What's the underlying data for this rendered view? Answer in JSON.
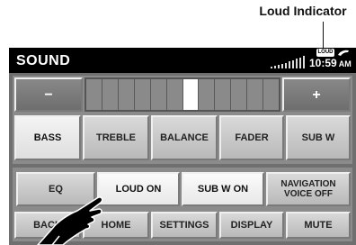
{
  "callout": {
    "label": "Loud Indicator"
  },
  "header": {
    "title": "SOUND",
    "time": "10:59",
    "ampm": "AM",
    "loud_badge": "LOUD"
  },
  "adjust": {
    "minus": "−",
    "plus": "+",
    "segments": 12,
    "active_segment": 6
  },
  "tabs": [
    {
      "label": "BASS",
      "state": "selected"
    },
    {
      "label": "TREBLE",
      "state": "normal"
    },
    {
      "label": "BALANCE",
      "state": "normal"
    },
    {
      "label": "FADER",
      "state": "normal"
    },
    {
      "label": "SUB W",
      "state": "normal"
    }
  ],
  "options": [
    {
      "label": "EQ",
      "state": "normal"
    },
    {
      "label": "LOUD ON",
      "state": "active"
    },
    {
      "label": "SUB W ON",
      "state": "active"
    },
    {
      "label": "NAVIGATION VOICE OFF",
      "state": "normal"
    }
  ],
  "bottom_bar": [
    {
      "label": "BACK"
    },
    {
      "label": "HOME"
    },
    {
      "label": "SETTINGS"
    },
    {
      "label": "DISPLAY"
    },
    {
      "label": "MUTE"
    }
  ]
}
